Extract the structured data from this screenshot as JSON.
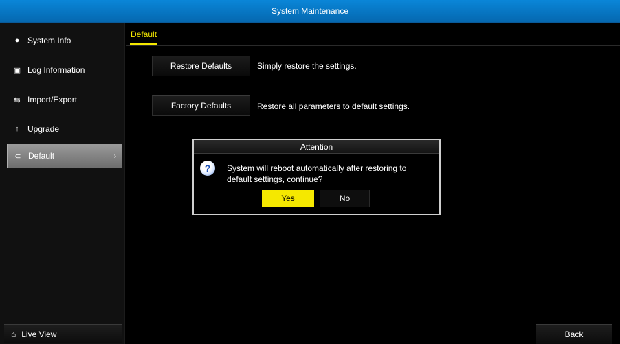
{
  "window": {
    "title": "System Maintenance"
  },
  "sidebar": {
    "items": [
      {
        "label": "System Info",
        "icon": "info-icon"
      },
      {
        "label": "Log Information",
        "icon": "log-icon"
      },
      {
        "label": "Import/Export",
        "icon": "import-export-icon"
      },
      {
        "label": "Upgrade",
        "icon": "upgrade-icon"
      },
      {
        "label": "Default",
        "icon": "default-icon",
        "active": true
      }
    ],
    "live_view_label": "Live View"
  },
  "main": {
    "tab_label": "Default",
    "restore_defaults": {
      "label": "Restore Defaults",
      "description": "Simply restore the settings."
    },
    "factory_defaults": {
      "label": "Factory Defaults",
      "description": "Restore all parameters to default settings."
    },
    "back_label": "Back"
  },
  "dialog": {
    "title": "Attention",
    "message": "System will reboot automatically after restoring to default settings, continue?",
    "yes_label": "Yes",
    "no_label": "No"
  },
  "colors": {
    "titlebar": "#0776c6",
    "accent": "#f5e800",
    "background": "#000000"
  }
}
